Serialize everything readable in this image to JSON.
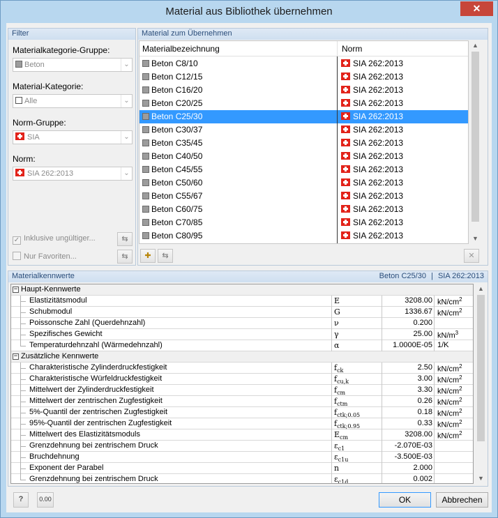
{
  "window": {
    "title": "Material aus Bibliothek übernehmen",
    "close_glyph": "✕"
  },
  "filter": {
    "heading": "Filter",
    "category_group_label": "Materialkategorie-Gruppe:",
    "category_group_value": "Beton",
    "category_label": "Material-Kategorie:",
    "category_value": "Alle",
    "norm_group_label": "Norm-Gruppe:",
    "norm_group_value": "SIA",
    "norm_label": "Norm:",
    "norm_value": "SIA 262:2013",
    "include_invalid_label": "Inklusive ungültiger...",
    "include_invalid_checked": true,
    "favorites_label": "Nur Favoriten...",
    "favorites_checked": false
  },
  "materials": {
    "heading": "Material zum Übernehmen",
    "col_name": "Materialbezeichnung",
    "col_norm": "Norm",
    "selected_index": 4,
    "rows": [
      {
        "name": "Beton C8/10",
        "norm": "SIA 262:2013"
      },
      {
        "name": "Beton C12/15",
        "norm": "SIA 262:2013"
      },
      {
        "name": "Beton C16/20",
        "norm": "SIA 262:2013"
      },
      {
        "name": "Beton C20/25",
        "norm": "SIA 262:2013"
      },
      {
        "name": "Beton C25/30",
        "norm": "SIA 262:2013"
      },
      {
        "name": "Beton C30/37",
        "norm": "SIA 262:2013"
      },
      {
        "name": "Beton C35/45",
        "norm": "SIA 262:2013"
      },
      {
        "name": "Beton C40/50",
        "norm": "SIA 262:2013"
      },
      {
        "name": "Beton C45/55",
        "norm": "SIA 262:2013"
      },
      {
        "name": "Beton C50/60",
        "norm": "SIA 262:2013"
      },
      {
        "name": "Beton C55/67",
        "norm": "SIA 262:2013"
      },
      {
        "name": "Beton C60/75",
        "norm": "SIA 262:2013"
      },
      {
        "name": "Beton C70/85",
        "norm": "SIA 262:2013"
      },
      {
        "name": "Beton C80/95",
        "norm": "SIA 262:2013"
      }
    ]
  },
  "properties": {
    "heading": "Materialkennwerte",
    "selected_material": "Beton C25/30",
    "separator": "|",
    "selected_norm": "SIA 262:2013",
    "groups": [
      {
        "title": "Haupt-Kennwerte",
        "rows": [
          {
            "name": "Elastizitätsmodul",
            "sym": "E",
            "sub": "",
            "val": "3208.00",
            "unit": "kN/cm",
            "sup": "2"
          },
          {
            "name": "Schubmodul",
            "sym": "G",
            "sub": "",
            "val": "1336.67",
            "unit": "kN/cm",
            "sup": "2"
          },
          {
            "name": "Poissonsche Zahl (Querdehnzahl)",
            "sym": "ν",
            "sub": "",
            "val": "0.200",
            "unit": "",
            "sup": ""
          },
          {
            "name": "Spezifisches Gewicht",
            "sym": "γ",
            "sub": "",
            "val": "25.00",
            "unit": "kN/m",
            "sup": "3"
          },
          {
            "name": "Temperaturdehnzahl (Wärmedehnzahl)",
            "sym": "α",
            "sub": "",
            "val": "1.0000E-05",
            "unit": "1/K",
            "sup": ""
          }
        ]
      },
      {
        "title": "Zusätzliche Kennwerte",
        "rows": [
          {
            "name": "Charakteristische Zylinderdruckfestigkeit",
            "sym": "f",
            "sub": "ck",
            "val": "2.50",
            "unit": "kN/cm",
            "sup": "2"
          },
          {
            "name": "Charakteristische Würfeldruckfestigkeit",
            "sym": "f",
            "sub": "cu,k",
            "val": "3.00",
            "unit": "kN/cm",
            "sup": "2"
          },
          {
            "name": "Mittelwert der Zylinderdruckfestigkeit",
            "sym": "f",
            "sub": "cm",
            "val": "3.30",
            "unit": "kN/cm",
            "sup": "2"
          },
          {
            "name": "Mittelwert der zentrischen Zugfestigkeit",
            "sym": "f",
            "sub": "ctm",
            "val": "0.26",
            "unit": "kN/cm",
            "sup": "2"
          },
          {
            "name": "5%-Quantil der zentrischen Zugfestigkeit",
            "sym": "f",
            "sub": "ctk;0.05",
            "val": "0.18",
            "unit": "kN/cm",
            "sup": "2"
          },
          {
            "name": "95%-Quantil der zentrischen Zugfestigkeit",
            "sym": "f",
            "sub": "ctk;0.95",
            "val": "0.33",
            "unit": "kN/cm",
            "sup": "2"
          },
          {
            "name": "Mittelwert des Elastizitätsmoduls",
            "sym": "E",
            "sub": "cm",
            "val": "3208.00",
            "unit": "kN/cm",
            "sup": "2"
          },
          {
            "name": "Grenzdehnung bei zentrischem Druck",
            "sym": "ε",
            "sub": "c1",
            "val": "-2.070E-03",
            "unit": "",
            "sup": ""
          },
          {
            "name": "Bruchdehnung",
            "sym": "ε",
            "sub": "c1u",
            "val": "-3.500E-03",
            "unit": "",
            "sup": ""
          },
          {
            "name": "Exponent der Parabel",
            "sym": "n",
            "sub": "",
            "val": "2.000",
            "unit": "",
            "sup": ""
          },
          {
            "name": "Grenzdehnung bei zentrischem Druck",
            "sym": "ε",
            "sub": "c1d",
            "val": "0.002",
            "unit": "",
            "sup": ""
          }
        ]
      }
    ]
  },
  "footer": {
    "ok_label": "OK",
    "cancel_label": "Abbrechen",
    "units_icon_text": "0.00"
  }
}
